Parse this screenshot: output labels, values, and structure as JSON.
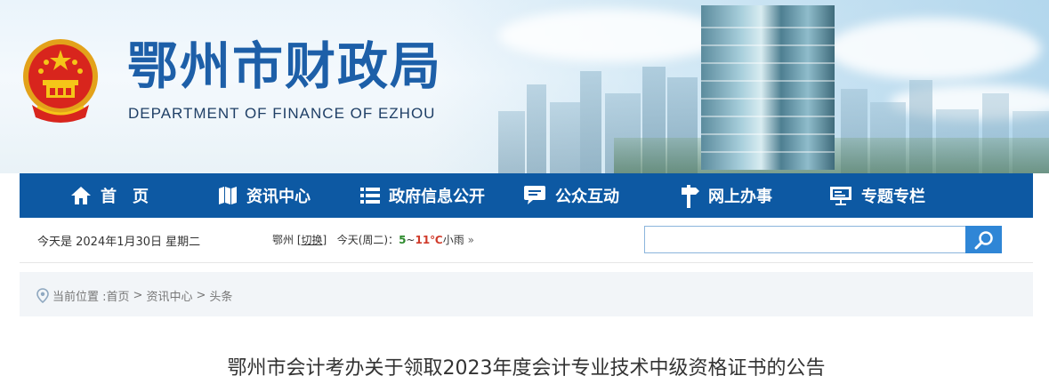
{
  "header": {
    "title_cn": "鄂州市财政局",
    "title_en": "DEPARTMENT OF FINANCE OF EZHOU",
    "emblem_icon": "national-emblem-icon"
  },
  "nav": {
    "items": [
      {
        "label": "首　页",
        "icon": "home-icon"
      },
      {
        "label": "资讯中心",
        "icon": "map-book-icon"
      },
      {
        "label": "政府信息公开",
        "icon": "list-icon"
      },
      {
        "label": "公众互动",
        "icon": "chat-icon"
      },
      {
        "label": "网上办事",
        "icon": "signpost-icon"
      },
      {
        "label": "专题专栏",
        "icon": "presentation-icon"
      }
    ]
  },
  "infobar": {
    "date": "今天是 2024年1月30日 星期二",
    "city": "鄂州",
    "switch_label": "切换",
    "weather_prefix": "今天(周二)：",
    "low": "5",
    "sep": "~",
    "high": "11℃",
    "condition": "小雨",
    "more": "»",
    "search_placeholder": "",
    "search_value": ""
  },
  "breadcrumb": {
    "prefix": "当前位置 :",
    "items": [
      "首页",
      "资讯中心",
      "头条"
    ],
    "separator": ">"
  },
  "article": {
    "title": "鄂州市会计考办关于领取2023年度会计专业技术中级资格证书的公告"
  },
  "colors": {
    "nav_bg": "#0d59a3",
    "title_blue": "#1d5fa8",
    "search_btn": "#2f86d6",
    "temp_low": "#2c8a2c",
    "temp_high": "#d03a2a"
  }
}
